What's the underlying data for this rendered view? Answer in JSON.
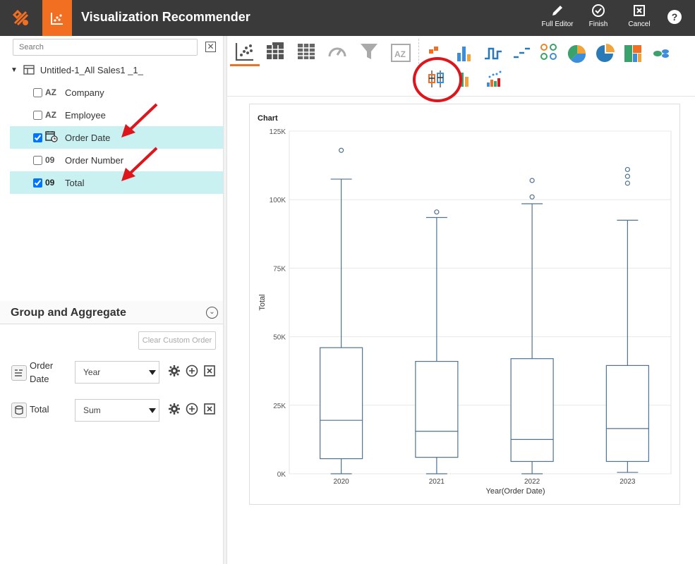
{
  "app": {
    "title": "Visualization Recommender",
    "toolbar": {
      "full_editor": "Full Editor",
      "finish": "Finish",
      "cancel": "Cancel",
      "help": "?"
    }
  },
  "fields": {
    "search_placeholder": "Search",
    "datasource": "Untitled-1_All Sales1 _1_",
    "items": [
      {
        "type": "AZ",
        "label": "Company",
        "checked": false
      },
      {
        "type": "AZ",
        "label": "Employee",
        "checked": false
      },
      {
        "type": "date",
        "label": "Order Date",
        "checked": true
      },
      {
        "type": "09",
        "label": "Order Number",
        "checked": false
      },
      {
        "type": "09",
        "label": "Total",
        "checked": true
      }
    ]
  },
  "group_aggregate": {
    "title": "Group and Aggregate",
    "clear_label": "Clear Custom Order",
    "rows": [
      {
        "label_line1": "Order",
        "label_line2": "Date",
        "func": "Year"
      },
      {
        "label_line1": "Total",
        "label_line2": "",
        "func": "Sum"
      }
    ]
  },
  "chart_data": {
    "type": "box",
    "title": "Chart",
    "xlabel": "Year(Order Date)",
    "ylabel": "Total",
    "ylim": [
      0,
      125000
    ],
    "y_ticks": [
      "0K",
      "25K",
      "50K",
      "75K",
      "100K",
      "125K"
    ],
    "categories": [
      "2020",
      "2021",
      "2022",
      "2023"
    ],
    "boxes": [
      {
        "min": 0,
        "q1": 5500,
        "median": 19500,
        "q3": 46000,
        "max": 107500,
        "outliers": [
          118000
        ]
      },
      {
        "min": 0,
        "q1": 6000,
        "median": 15500,
        "q3": 41000,
        "max": 93500,
        "outliers": [
          95500
        ]
      },
      {
        "min": 0,
        "q1": 4500,
        "median": 12500,
        "q3": 42000,
        "max": 98500,
        "outliers": [
          101000,
          107000
        ]
      },
      {
        "min": 500,
        "q1": 4500,
        "median": 16500,
        "q3": 39500,
        "max": 92500,
        "outliers": [
          106000,
          108500,
          111000
        ]
      }
    ],
    "color": "#4f7391"
  },
  "colors": {
    "accent": "#f26e21",
    "topbar": "#3a3a3a",
    "selection": "#c9f1f1",
    "annotation": "#e0141b"
  }
}
